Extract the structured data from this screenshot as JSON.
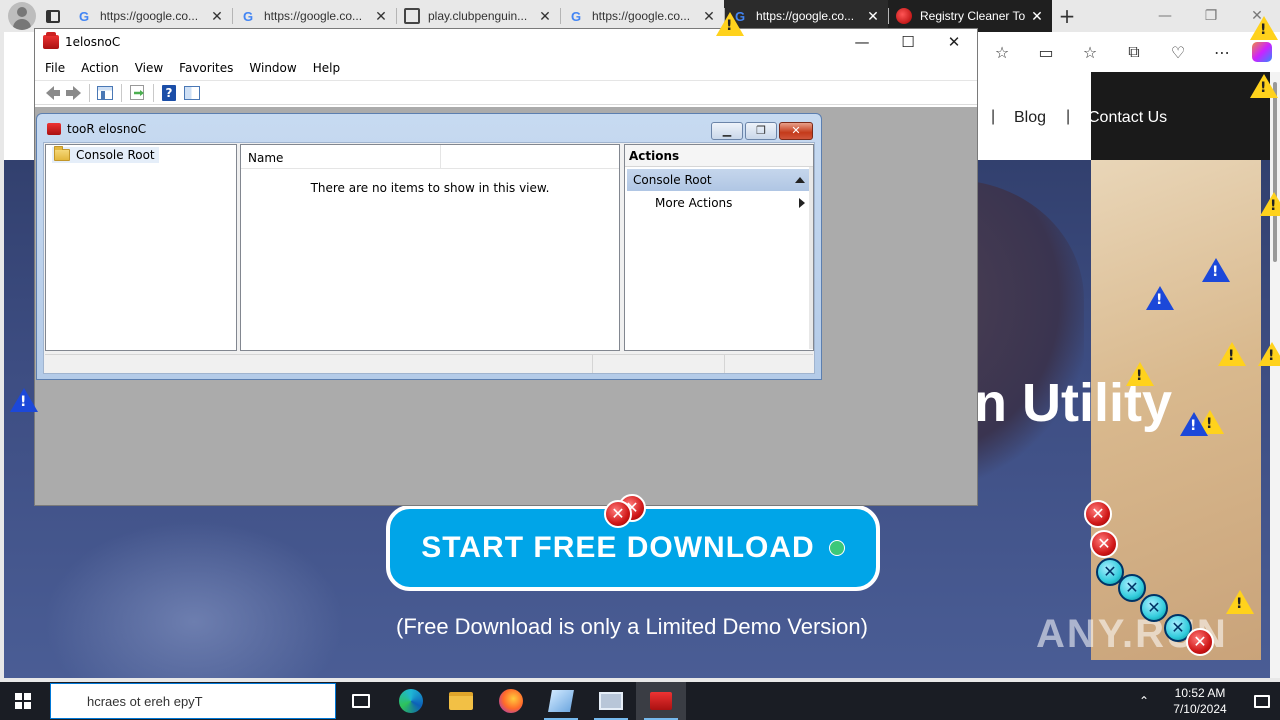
{
  "browser": {
    "tabs": [
      {
        "title": "https://google.co...",
        "favicon": "google-icon",
        "theme": "light"
      },
      {
        "title": "https://google.co...",
        "favicon": "google-icon",
        "theme": "light"
      },
      {
        "title": "play.clubpenguin...",
        "favicon": "page-icon",
        "theme": "light"
      },
      {
        "title": "https://google.co...",
        "favicon": "google-icon",
        "theme": "light"
      },
      {
        "title": "https://google.co...",
        "favicon": "google-icon",
        "theme": "dark"
      },
      {
        "title": "Registry Cleaner To...",
        "favicon": "registry-cleaner-icon",
        "theme": "active"
      }
    ],
    "new_tab": "+",
    "window_controls": {
      "minimize": "—",
      "maximize": "❐",
      "close": "✕"
    },
    "toolbar": {
      "favorite": "☆",
      "split": "▭",
      "favorites": "☆",
      "collections": "⧉",
      "performance": "♡",
      "more": "⋯"
    }
  },
  "webpage": {
    "nav": {
      "separator": "|",
      "blog": "Blog",
      "contact": "Contact Us"
    },
    "hero_title_fragment": "n Utility",
    "download_button": "START FREE DOWNLOAD",
    "download_note": "(Free Download is only a Limited Demo Version)",
    "watermark": "ANY.RUN"
  },
  "mmc": {
    "title": "1elosnoC",
    "window_controls": {
      "minimize": "—",
      "maximize": "☐",
      "close": "✕"
    },
    "menu": [
      "File",
      "Action",
      "View",
      "Favorites",
      "Window",
      "Help"
    ],
    "toolbar_icons": [
      "back-arrow-icon",
      "forward-arrow-icon",
      "show-tree-icon",
      "export-list-icon",
      "help-icon",
      "show-action-pane-icon"
    ],
    "child": {
      "title": "tooR elosnoC",
      "buttons": {
        "minimize": "▁",
        "restore": "❐",
        "close": "✕"
      },
      "tree_root": "Console Root",
      "list_column": "Name",
      "empty_message": "There are no items to show in this view.",
      "actions_title": "Actions",
      "actions_section": "Console Root",
      "actions_item": "More Actions"
    }
  },
  "taskbar": {
    "search_placeholder": "hcraes ot ereh epyT",
    "apps": [
      "task-view-icon",
      "edge-icon",
      "file-explorer-icon",
      "firefox-icon",
      "notes-icon",
      "display-icon",
      "mmc-icon"
    ],
    "time": "10:52 AM",
    "date": "7/10/2024"
  },
  "colors": {
    "download_button": "#00a5e8",
    "hero_bg": "#3d4d82",
    "warning": "#ffd21c",
    "info": "#1c48d9",
    "error": "#d01818"
  }
}
